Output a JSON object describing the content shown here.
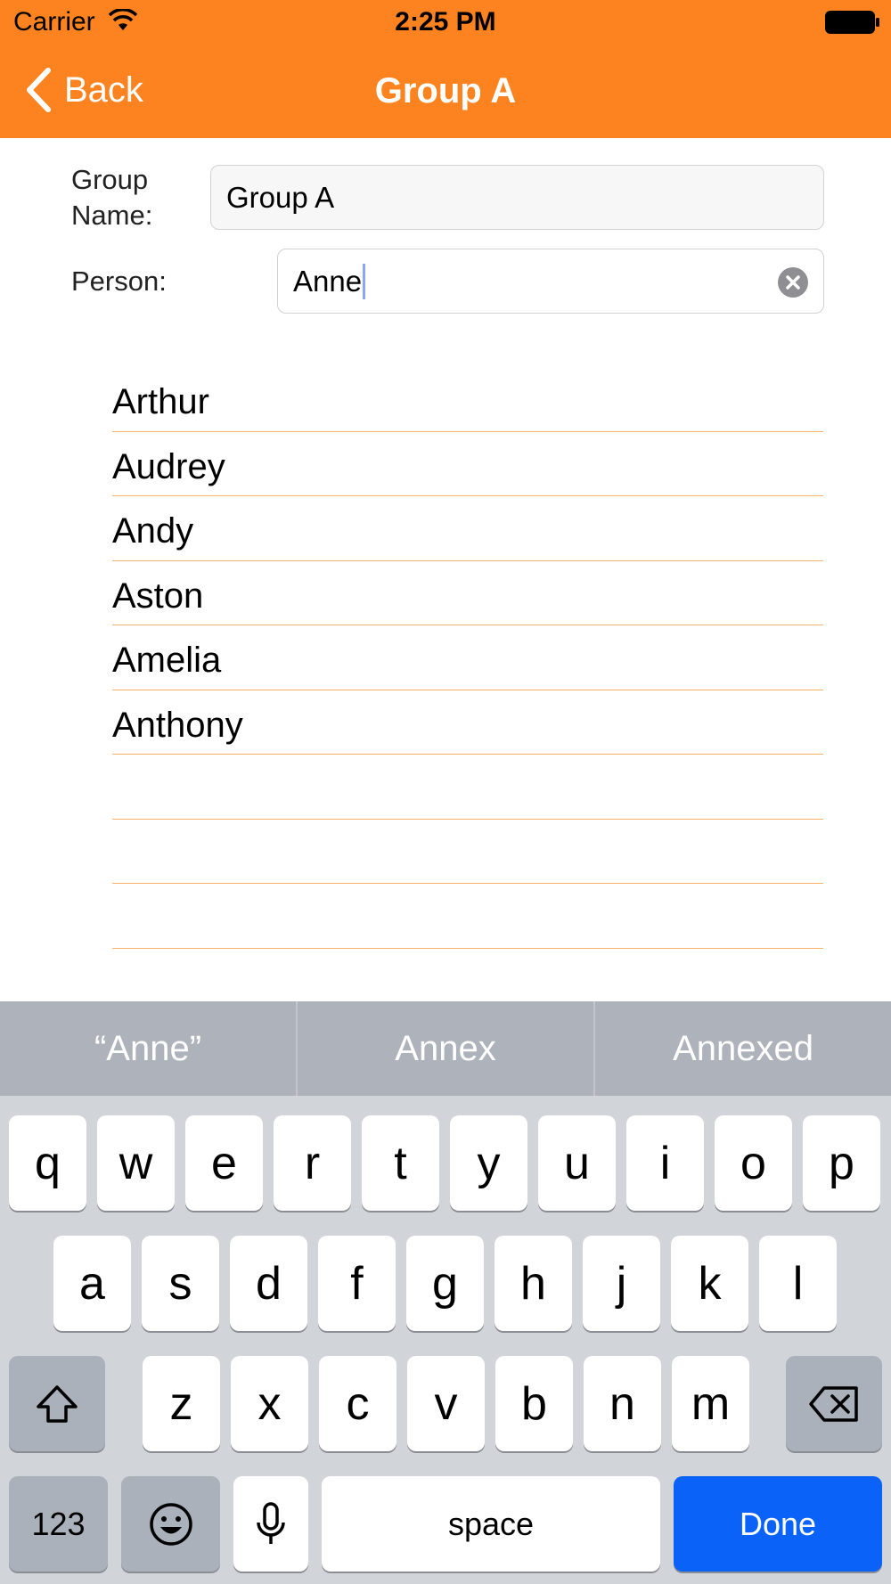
{
  "status_bar": {
    "carrier": "Carrier",
    "time": "2:25 PM"
  },
  "nav": {
    "back_label": "Back",
    "title": "Group A"
  },
  "form": {
    "group_name_label": "Group Name:",
    "group_name_value": "Group A",
    "person_label": "Person:",
    "person_value": "Anne"
  },
  "suggestions": [
    "Arthur",
    "Audrey",
    "Andy",
    "Aston",
    "Amelia",
    "Anthony",
    "",
    "",
    ""
  ],
  "keyboard": {
    "predictions": [
      "“Anne”",
      "Annex",
      "Annexed"
    ],
    "row1": [
      "q",
      "w",
      "e",
      "r",
      "t",
      "y",
      "u",
      "i",
      "o",
      "p"
    ],
    "row2": [
      "a",
      "s",
      "d",
      "f",
      "g",
      "h",
      "j",
      "k",
      "l"
    ],
    "row3": [
      "z",
      "x",
      "c",
      "v",
      "b",
      "n",
      "m"
    ],
    "numbers_label": "123",
    "space_label": "space",
    "done_label": "Done"
  },
  "colors": {
    "accent": "#fc8320",
    "done_key": "#0b62f8",
    "divider": "#f4b26e"
  },
  "icons": [
    "wifi-icon",
    "battery-icon",
    "back-chevron-icon",
    "clear-icon",
    "shift-icon",
    "backspace-icon",
    "emoji-icon",
    "microphone-icon"
  ]
}
